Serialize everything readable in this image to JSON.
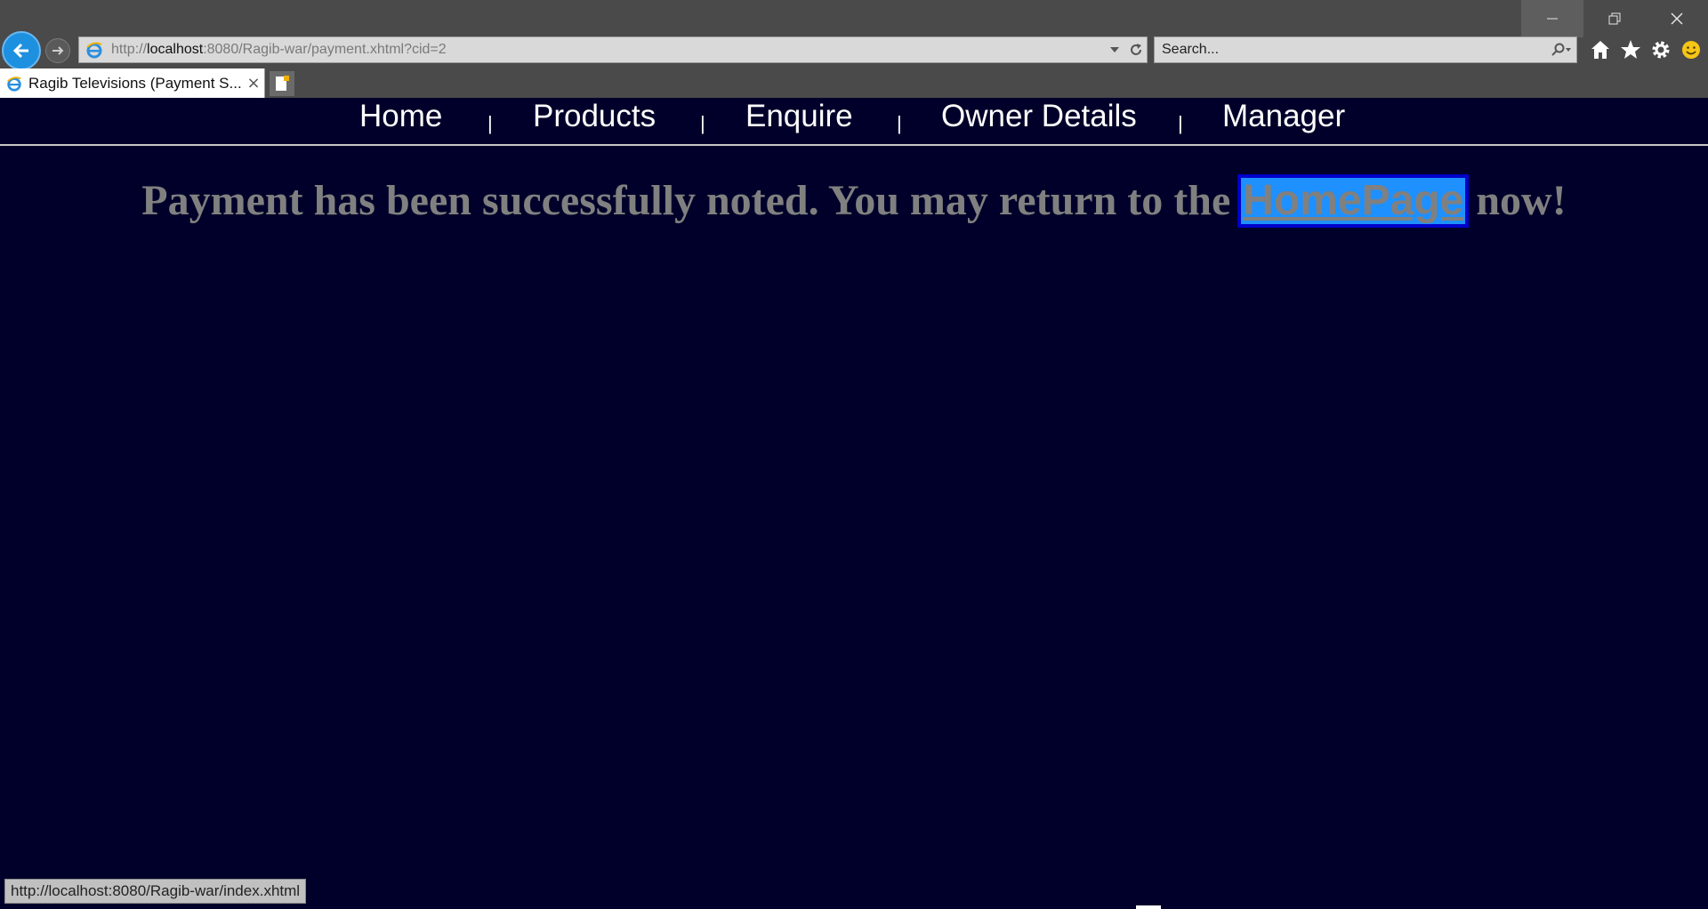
{
  "browser": {
    "address": {
      "prefix": "http://",
      "host": "localhost",
      "path": ":8080/Ragib-war/payment.xhtml?cid=2"
    },
    "search_placeholder": "Search...",
    "tab_title": "Ragib Televisions (Payment S...",
    "tab_close": "×",
    "status_text": "http://localhost:8080/Ragib-war/index.xhtml"
  },
  "nav": {
    "items": [
      "Home",
      "Products",
      "Enquire",
      "Owner Details",
      "Manager"
    ],
    "separator": "|"
  },
  "message": {
    "before": "Payment has been successfully noted. You may return to the ",
    "link": "HomePage",
    "after": " now!"
  },
  "colors": {
    "page_background": "#00002a",
    "link_highlight": "#1e90ff",
    "message_text": "#808080"
  }
}
